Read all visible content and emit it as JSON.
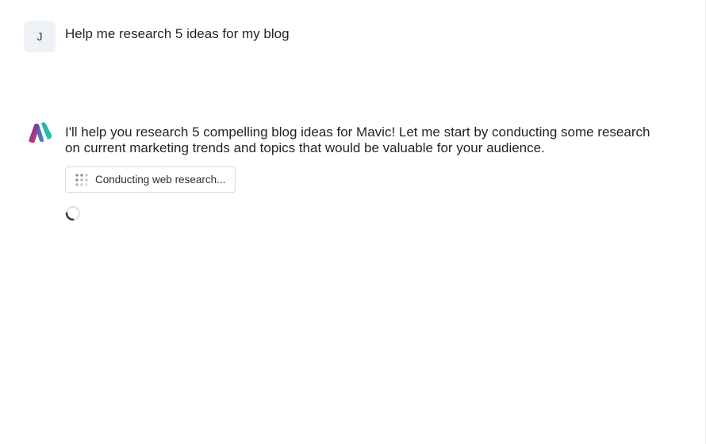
{
  "user_message": {
    "avatar_initial": "J",
    "text": "Help me research 5 ideas for my blog"
  },
  "assistant_message": {
    "logo_icon": "mavic-logo-icon",
    "text": "I'll help you research 5 compelling blog ideas for Mavic! Let me start by conducting some research on current marketing trends and topics that would be valuable for your audience.",
    "tool_status": {
      "icon": "dots-grid-icon",
      "label": "Conducting web research..."
    },
    "loading_icon": "spinner-icon"
  },
  "colors": {
    "avatar_bg": "#eef1f5",
    "logo_pink": "#e8437d",
    "logo_purple": "#6b3fa0",
    "logo_teal": "#2bb3a3"
  }
}
